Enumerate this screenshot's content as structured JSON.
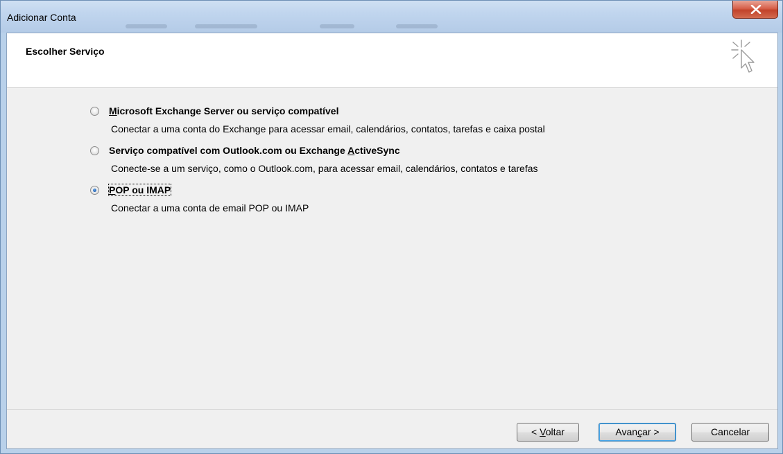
{
  "window": {
    "title": "Adicionar Conta",
    "close_label": "x"
  },
  "header": {
    "title": "Escolher Serviço",
    "icon": "wizard-pointer-icon"
  },
  "options": [
    {
      "label_mnemonic": "M",
      "label_rest": "icrosoft Exchange Server ou serviço compatível",
      "description": "Conectar a uma conta do Exchange para acessar email, calendários, contatos, tarefas e caixa postal",
      "selected": false
    },
    {
      "label_pre": "Serviço compatível com Outlook.com ou Exchange ",
      "label_mnemonic": "A",
      "label_rest": "ctiveSync",
      "description": "Conecte-se a um serviço, como o Outlook.com, para acessar email, calendários, contatos e tarefas",
      "selected": false
    },
    {
      "label_mnemonic": "P",
      "label_rest": "OP ou IMAP",
      "description": "Conectar a uma conta de email POP ou IMAP",
      "selected": true
    }
  ],
  "buttons": {
    "back_pre": "< ",
    "back_mnemonic": "V",
    "back_rest": "oltar",
    "next_pre": "Avan",
    "next_mnemonic": "ç",
    "next_rest": "ar >",
    "cancel": "Cancelar"
  },
  "colors": {
    "frame": "#b9d1ea",
    "client": "#f0f0f0",
    "close": "#c2432b",
    "radio_selected": "#1d5fb3"
  }
}
